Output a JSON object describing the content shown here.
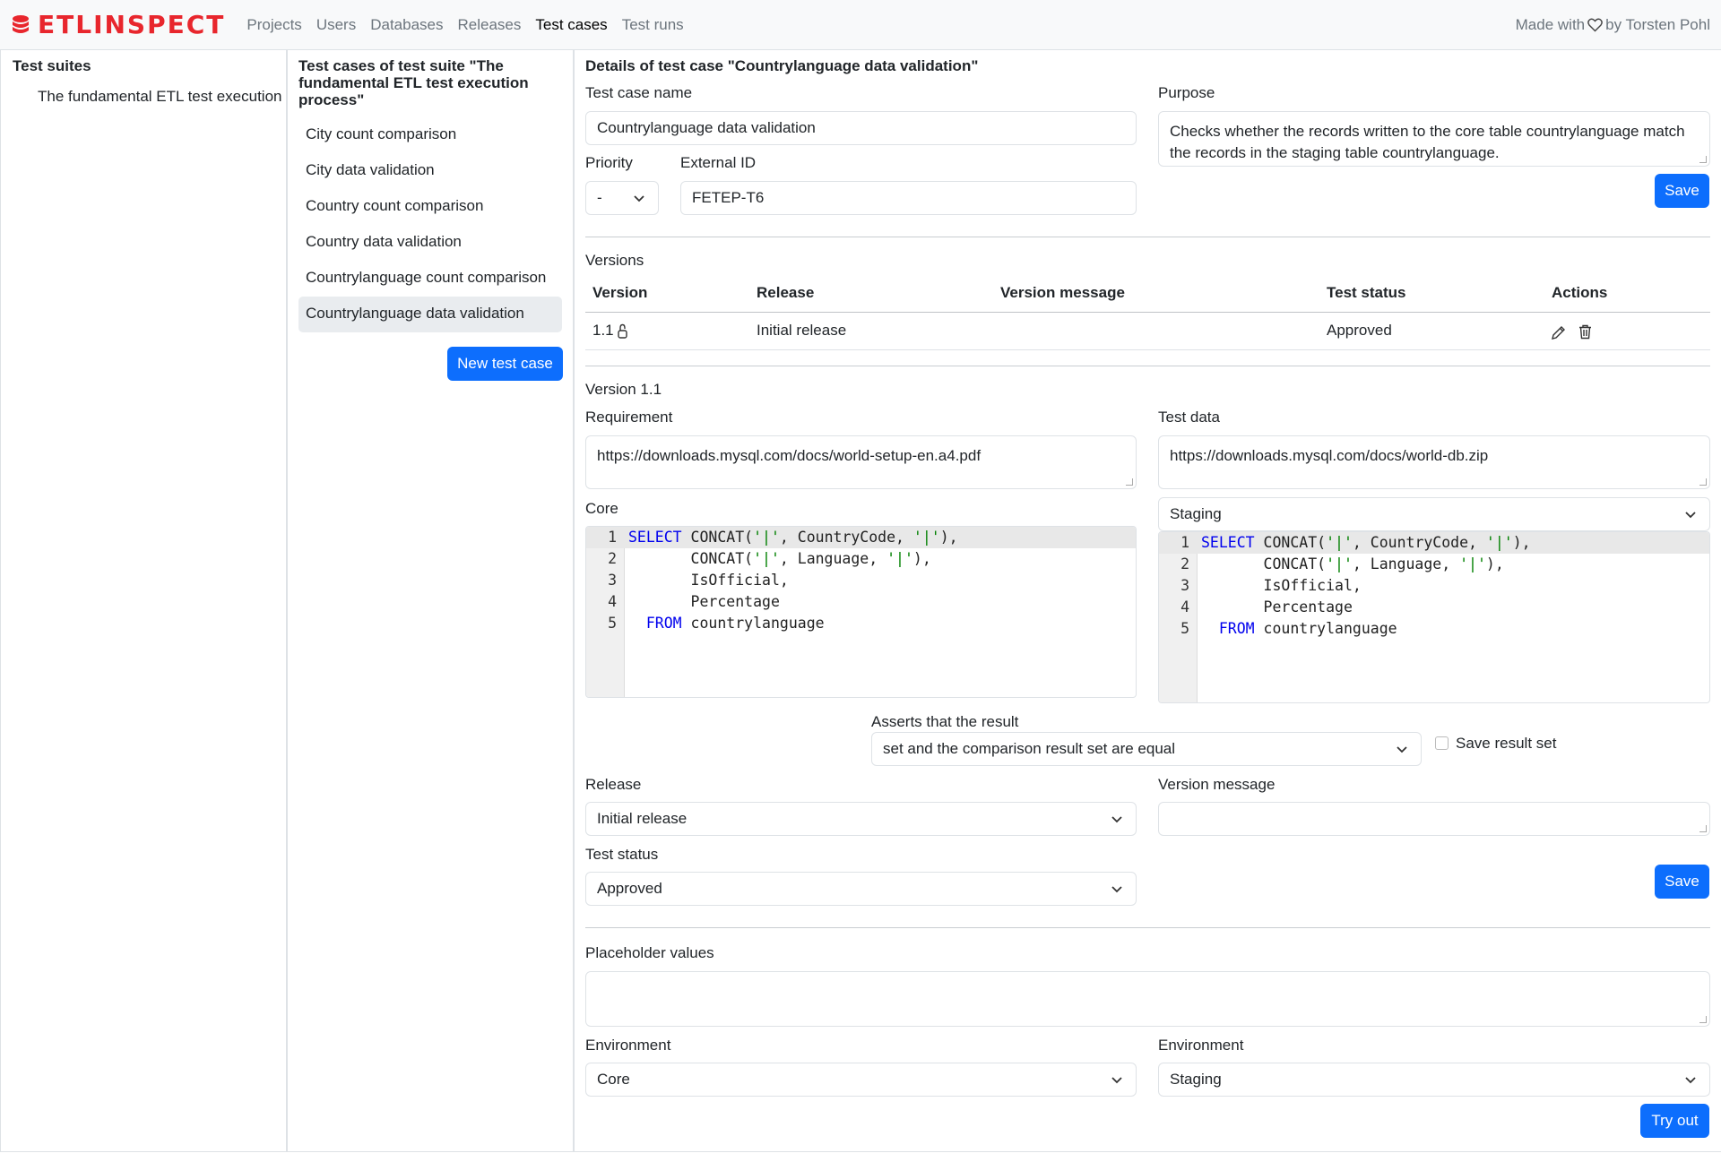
{
  "brand": {
    "name": "ETLINSPECT",
    "accent": "#e8262d"
  },
  "nav": {
    "items": [
      "Projects",
      "Users",
      "Databases",
      "Releases",
      "Test cases",
      "Test runs"
    ],
    "active": "Test cases"
  },
  "made_with": {
    "prefix": "Made with",
    "suffix": "by Torsten Pohl",
    "icon": "heart-icon"
  },
  "suites": {
    "title": "Test suites",
    "items": [
      "The fundamental ETL test execution"
    ]
  },
  "test_cases": {
    "title": "Test cases of test suite \"The fundamental ETL test execution process\"",
    "items": [
      "City count comparison",
      "City data validation",
      "Country count comparison",
      "Country data validation",
      "Countrylanguage count comparison",
      "Countrylanguage data validation"
    ],
    "active_index": 5,
    "new_button": "New test case"
  },
  "details": {
    "title": "Details of test case \"Countrylanguage data validation\"",
    "name_label": "Test case name",
    "name_value": "Countrylanguage data validation",
    "purpose_label": "Purpose",
    "purpose_value": "Checks whether the records written to the core table countrylanguage match the records in the staging table countrylanguage.",
    "priority_label": "Priority",
    "priority_value": "-",
    "external_id_label": "External ID",
    "external_id_value": "FETEP-T6",
    "save_label": "Save"
  },
  "versions": {
    "title": "Versions",
    "headers": [
      "Version",
      "Release",
      "Version message",
      "Test status",
      "Actions"
    ],
    "rows": [
      {
        "version": "1.1",
        "release": "Initial release",
        "message": "",
        "status": "Approved"
      }
    ]
  },
  "version": {
    "title": "Version 1.1",
    "requirement_label": "Requirement",
    "requirement_value": "https://downloads.mysql.com/docs/world-setup-en.a4.pdf",
    "test_data_label": "Test data",
    "test_data_value": "https://downloads.mysql.com/docs/world-db.zip",
    "core_label": "Core",
    "staging_select": "Staging",
    "asserts_label": "Asserts that the result",
    "asserts_value": "set and the comparison result set are equal",
    "save_result_label": "Save result set",
    "release_label": "Release",
    "release_value": "Initial release",
    "version_message_label": "Version message",
    "version_message_value": "",
    "test_status_label": "Test status",
    "test_status_value": "Approved",
    "save_label": "Save"
  },
  "placeholders": {
    "label": "Placeholder values",
    "value": "",
    "env1_label": "Environment",
    "env1_value": "Core",
    "env2_label": "Environment",
    "env2_value": "Staging",
    "try_label": "Try out"
  },
  "colors": {
    "primary": "#0d6efd",
    "border": "#dee2e6",
    "keyword": "#0000ee",
    "string": "#008000"
  }
}
